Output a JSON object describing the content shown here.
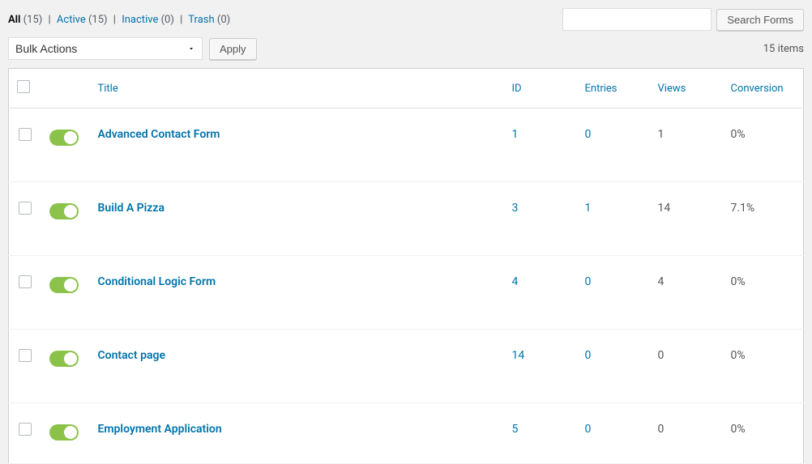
{
  "filters": {
    "all_label": "All",
    "all_count": "(15)",
    "active_label": "Active",
    "active_count": "(15)",
    "inactive_label": "Inactive",
    "inactive_count": "(0)",
    "trash_label": "Trash",
    "trash_count": "(0)"
  },
  "search": {
    "button": "Search Forms",
    "placeholder": ""
  },
  "bulk": {
    "placeholder": "Bulk Actions",
    "apply": "Apply"
  },
  "pagination": {
    "items_text": "15 items"
  },
  "columns": {
    "title": "Title",
    "id": "ID",
    "entries": "Entries",
    "views": "Views",
    "conversion": "Conversion"
  },
  "rows": [
    {
      "title": "Advanced Contact Form",
      "id": "1",
      "entries": "0",
      "views": "1",
      "conversion": "0%"
    },
    {
      "title": "Build A Pizza",
      "id": "3",
      "entries": "1",
      "views": "14",
      "conversion": "7.1%"
    },
    {
      "title": "Conditional Logic Form",
      "id": "4",
      "entries": "0",
      "views": "4",
      "conversion": "0%"
    },
    {
      "title": "Contact page",
      "id": "14",
      "entries": "0",
      "views": "0",
      "conversion": "0%"
    },
    {
      "title": "Employment Application",
      "id": "5",
      "entries": "0",
      "views": "0",
      "conversion": "0%"
    }
  ]
}
